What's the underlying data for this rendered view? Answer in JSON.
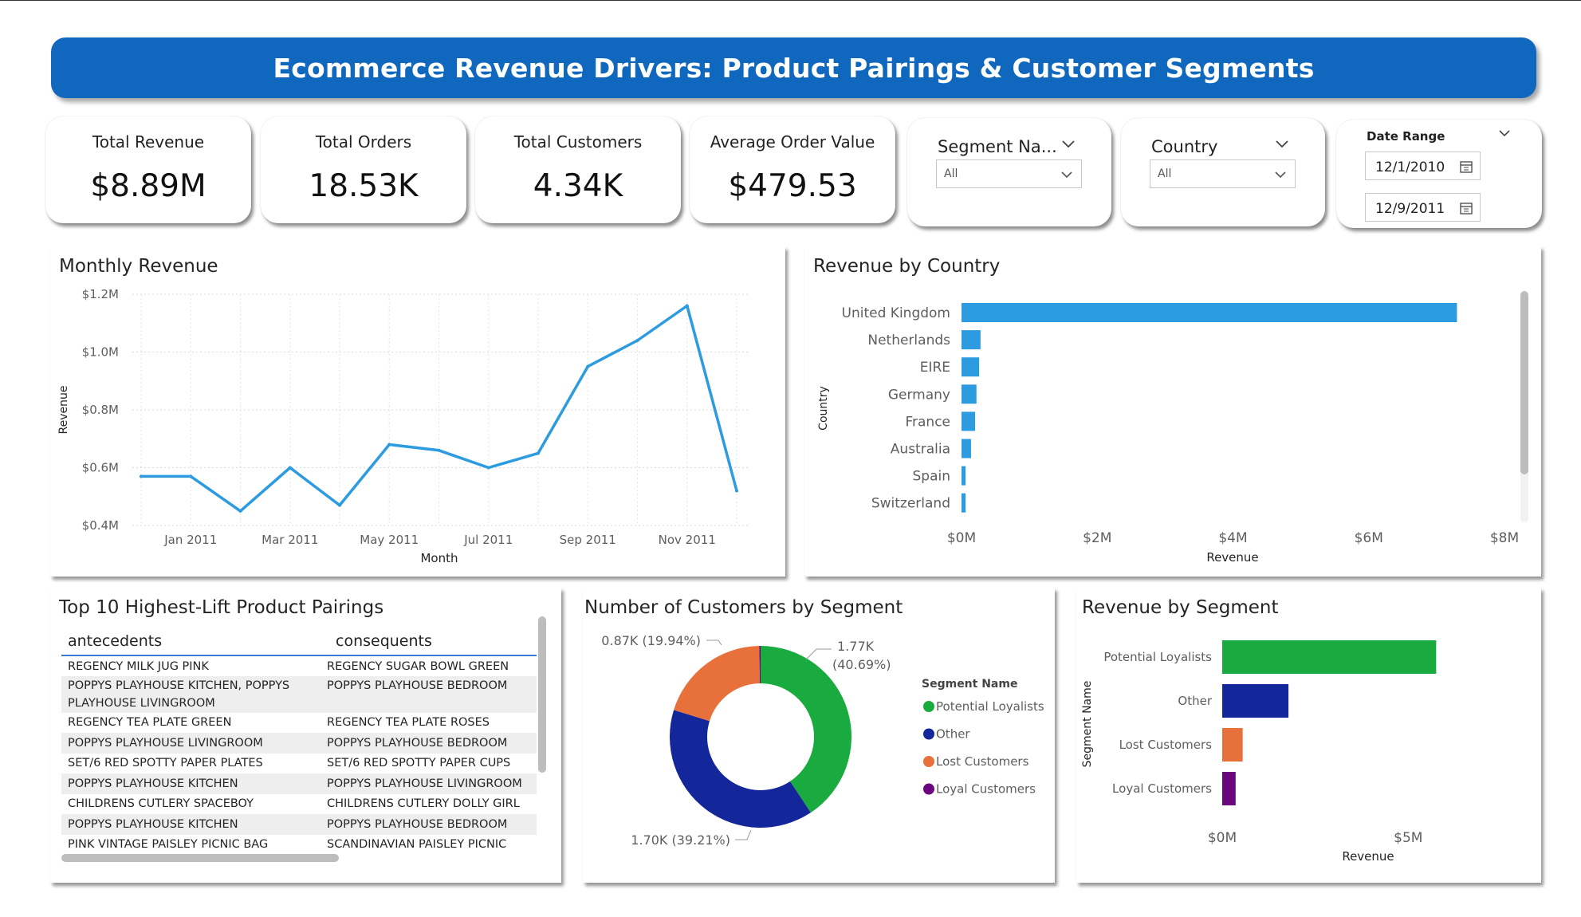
{
  "banner": {
    "title": "Ecommerce Revenue Drivers: Product Pairings & Customer Segments"
  },
  "kpis": [
    {
      "label": "Total Revenue",
      "value": "$8.89M"
    },
    {
      "label": "Total Orders",
      "value": "18.53K"
    },
    {
      "label": "Total Customers",
      "value": "4.34K"
    },
    {
      "label": "Average Order Value",
      "value": "$479.53"
    }
  ],
  "slicers": {
    "segment": {
      "title": "Segment Na...",
      "value": "All"
    },
    "country": {
      "title": "Country",
      "value": "All"
    },
    "date_range": {
      "title": "Date Range",
      "start": "12/1/2010",
      "end": "12/9/2011"
    }
  },
  "icons": {
    "dropdown": "chevron-down-icon",
    "calendar": "calendar-icon"
  },
  "colors": {
    "banner": "#0f68be",
    "line": "#2c9be0",
    "bar": "#2c9be0",
    "potential": "#1aab40",
    "other": "#14279a",
    "lost": "#e8703b",
    "loyal": "#6b067e"
  },
  "panels": {
    "monthly": {
      "title": "Monthly Revenue"
    },
    "country": {
      "title": "Revenue by Country"
    },
    "pairings": {
      "title": "Top 10 Highest-Lift Product Pairings"
    },
    "customers": {
      "title": "Number of Customers by Segment"
    },
    "segrev": {
      "title": "Revenue by Segment"
    }
  },
  "pairings_table": {
    "columns": [
      "antecedents",
      "consequents"
    ],
    "rows": [
      [
        "REGENCY MILK JUG PINK",
        "REGENCY SUGAR BOWL GREEN"
      ],
      [
        "POPPYS PLAYHOUSE KITCHEN, POPPYS PLAYHOUSE LIVINGROOM",
        "POPPYS PLAYHOUSE BEDROOM"
      ],
      [
        "REGENCY TEA PLATE GREEN",
        "REGENCY TEA PLATE ROSES"
      ],
      [
        "POPPYS PLAYHOUSE LIVINGROOM",
        "POPPYS PLAYHOUSE BEDROOM"
      ],
      [
        "SET/6 RED SPOTTY PAPER PLATES",
        "SET/6 RED SPOTTY PAPER CUPS"
      ],
      [
        "POPPYS PLAYHOUSE KITCHEN",
        "POPPYS PLAYHOUSE LIVINGROOM"
      ],
      [
        "CHILDRENS CUTLERY SPACEBOY",
        "CHILDRENS CUTLERY DOLLY GIRL"
      ],
      [
        "POPPYS PLAYHOUSE KITCHEN",
        "POPPYS PLAYHOUSE BEDROOM"
      ],
      [
        "PINK VINTAGE PAISLEY PICNIC BAG",
        "SCANDINAVIAN PAISLEY PICNIC BAG"
      ]
    ]
  },
  "chart_data": [
    {
      "type": "line",
      "title": "Monthly Revenue",
      "xlabel": "Month",
      "ylabel": "Revenue",
      "x": [
        "Dec 2010",
        "Jan 2011",
        "Feb 2011",
        "Mar 2011",
        "Apr 2011",
        "May 2011",
        "Jun 2011",
        "Jul 2011",
        "Aug 2011",
        "Sep 2011",
        "Oct 2011",
        "Nov 2011",
        "Dec 2011"
      ],
      "values": [
        0.57,
        0.57,
        0.45,
        0.6,
        0.47,
        0.68,
        0.66,
        0.6,
        0.65,
        0.95,
        1.04,
        1.16,
        0.52
      ],
      "ylim": [
        0.4,
        1.2
      ],
      "y_ticks": [
        "$0.4M",
        "$0.6M",
        "$0.8M",
        "$1.0M",
        "$1.2M"
      ],
      "x_ticks": [
        "Jan 2011",
        "Mar 2011",
        "May 2011",
        "Jul 2011",
        "Sep 2011",
        "Nov 2011"
      ],
      "grid": true
    },
    {
      "type": "bar",
      "orientation": "horizontal",
      "title": "Revenue by Country",
      "xlabel": "Revenue",
      "ylabel": "Country",
      "categories": [
        "United Kingdom",
        "Netherlands",
        "EIRE",
        "Germany",
        "France",
        "Australia",
        "Spain",
        "Switzerland"
      ],
      "values": [
        7.3,
        0.28,
        0.26,
        0.22,
        0.2,
        0.14,
        0.06,
        0.06
      ],
      "xlim": [
        0,
        8
      ],
      "x_ticks": [
        "$0M",
        "$2M",
        "$4M",
        "$6M",
        "$8M"
      ]
    },
    {
      "type": "pie",
      "variant": "donut",
      "title": "Number of Customers by Segment",
      "legend_title": "Segment Name",
      "legend_position": "right",
      "slices": [
        {
          "name": "Potential Loyalists",
          "value": 1.77,
          "label_line1": "1.77K",
          "label_line2": "(40.69%)"
        },
        {
          "name": "Other",
          "value": 1.7,
          "label": "1.70K (39.21%)"
        },
        {
          "name": "Lost Customers",
          "value": 0.87,
          "label": "0.87K (19.94%)"
        },
        {
          "name": "Loyal Customers",
          "value": 0.01,
          "label": ""
        }
      ]
    },
    {
      "type": "bar",
      "orientation": "horizontal",
      "title": "Revenue by Segment",
      "xlabel": "Revenue",
      "ylabel": "Segment Name",
      "categories": [
        "Potential Loyalists",
        "Other",
        "Lost Customers",
        "Loyal Customers"
      ],
      "values": [
        5.75,
        1.78,
        0.55,
        0.36
      ],
      "xlim": [
        0,
        7.5
      ],
      "x_ticks": [
        "$0M",
        "$5M"
      ]
    }
  ]
}
